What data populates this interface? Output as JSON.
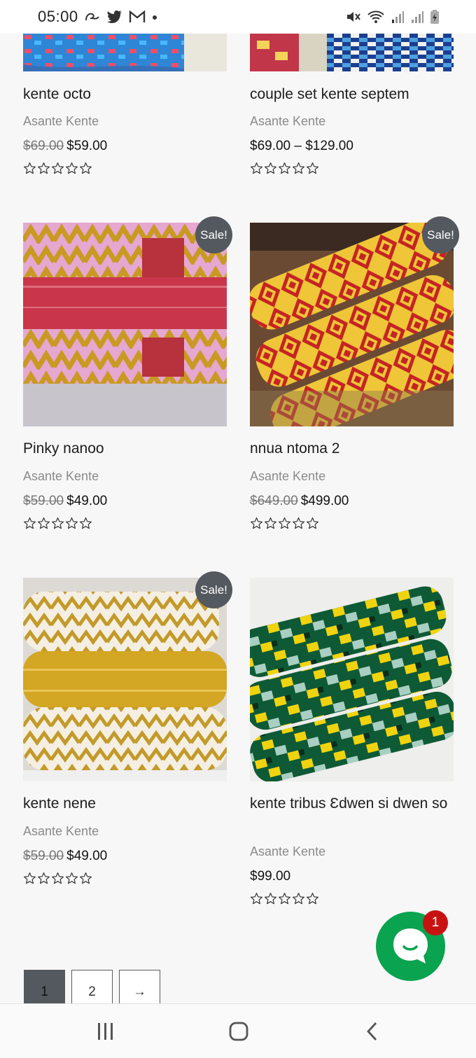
{
  "status_bar": {
    "time": "05:00",
    "left_icons": [
      "chat-app-icon",
      "twitter-icon",
      "gmail-icon",
      "dot-icon"
    ],
    "right_icons": [
      "mute-icon",
      "wifi-icon",
      "signal-icon",
      "signal-icon-2",
      "battery-icon"
    ]
  },
  "products": [
    {
      "title": "kente octo",
      "category": "Asante Kente",
      "old_price": "$69.00",
      "price": "$59.00",
      "sale": false,
      "rating": 0
    },
    {
      "title": "couple set kente septem",
      "category": "Asante Kente",
      "old_price": "",
      "price": "$69.00 – $129.00",
      "sale": false,
      "rating": 0
    },
    {
      "title": "Pinky nanoo",
      "category": "Asante Kente",
      "old_price": "$59.00",
      "price": "$49.00",
      "sale": true,
      "sale_label": "Sale!",
      "rating": 0
    },
    {
      "title": "nnua ntoma 2",
      "category": "Asante Kente",
      "old_price": "$649.00",
      "price": "$499.00",
      "sale": true,
      "sale_label": "Sale!",
      "rating": 0
    },
    {
      "title": "kente nene",
      "category": "Asante Kente",
      "old_price": "$59.00",
      "price": "$49.00",
      "sale": true,
      "sale_label": "Sale!",
      "rating": 0
    },
    {
      "title": "kente tribus Ɛdwen si dwen so",
      "category": "Asante Kente",
      "old_price": "",
      "price": "$99.00",
      "sale": false,
      "rating": 0
    }
  ],
  "pagination": {
    "pages": [
      "1",
      "2"
    ],
    "current": "1",
    "next_label": "→"
  },
  "chat": {
    "unread": "1",
    "icon": "chat-bubble-icon"
  },
  "nav_bar": {
    "icons": [
      "recent-apps-icon",
      "home-icon",
      "back-icon"
    ]
  },
  "colors": {
    "sale_badge": "#54595f",
    "chat": "#0aa34f",
    "chat_badge": "#c81212",
    "active_page": "#53595f"
  }
}
